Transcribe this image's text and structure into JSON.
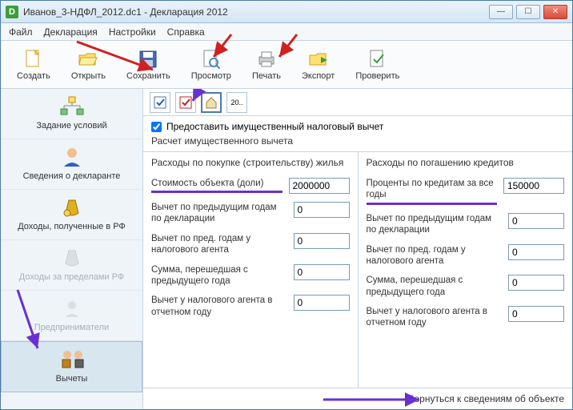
{
  "window": {
    "title": "Иванов_3-НДФЛ_2012.dc1 - Декларация 2012"
  },
  "menu": {
    "file": "Файл",
    "decl": "Декларация",
    "settings": "Настройки",
    "help": "Справка"
  },
  "toolbar": {
    "create": "Создать",
    "open": "Открыть",
    "save": "Сохранить",
    "preview": "Просмотр",
    "print": "Печать",
    "export": "Экспорт",
    "check": "Проверить"
  },
  "sidebar": {
    "conditions": "Задание условий",
    "declarant": "Сведения о декларанте",
    "income_rf": "Доходы, полученные в РФ",
    "income_abroad": "Доходы за пределами РФ",
    "entrepreneurs": "Предприниматели",
    "deductions": "Вычеты"
  },
  "main": {
    "checkbox_label": "Предоставить имущественный налоговый вычет",
    "calc_label": "Расчет имущественного вычета",
    "left": {
      "header": "Расходы по покупке (строительству) жилья",
      "f1_label": "Стоимость объекта (доли)",
      "f1_value": "2000000",
      "f2_label": "Вычет по предыдущим годам по декларации",
      "f2_value": "0",
      "f3_label": "Вычет по пред. годам у налогового агента",
      "f3_value": "0",
      "f4_label": "Сумма, перешедшая с предыдущего года",
      "f4_value": "0",
      "f5_label": "Вычет у налогового агента в отчетном году",
      "f5_value": "0"
    },
    "right": {
      "header": "Расходы по погашению кредитов",
      "f1_label": "Проценты по кредитам за все годы",
      "f1_value": "150000",
      "f2_label": "Вычет по предыдущим годам по декларации",
      "f2_value": "0",
      "f3_label": "Вычет по пред. годам у налогового агента",
      "f3_value": "0",
      "f4_label": "Сумма, перешедшая с предыдущего года",
      "f4_value": "0",
      "f5_label": "Вычет у налогового агента в отчетном году",
      "f5_value": "0"
    },
    "footer_link": "Вернуться к сведениям об объекте"
  }
}
